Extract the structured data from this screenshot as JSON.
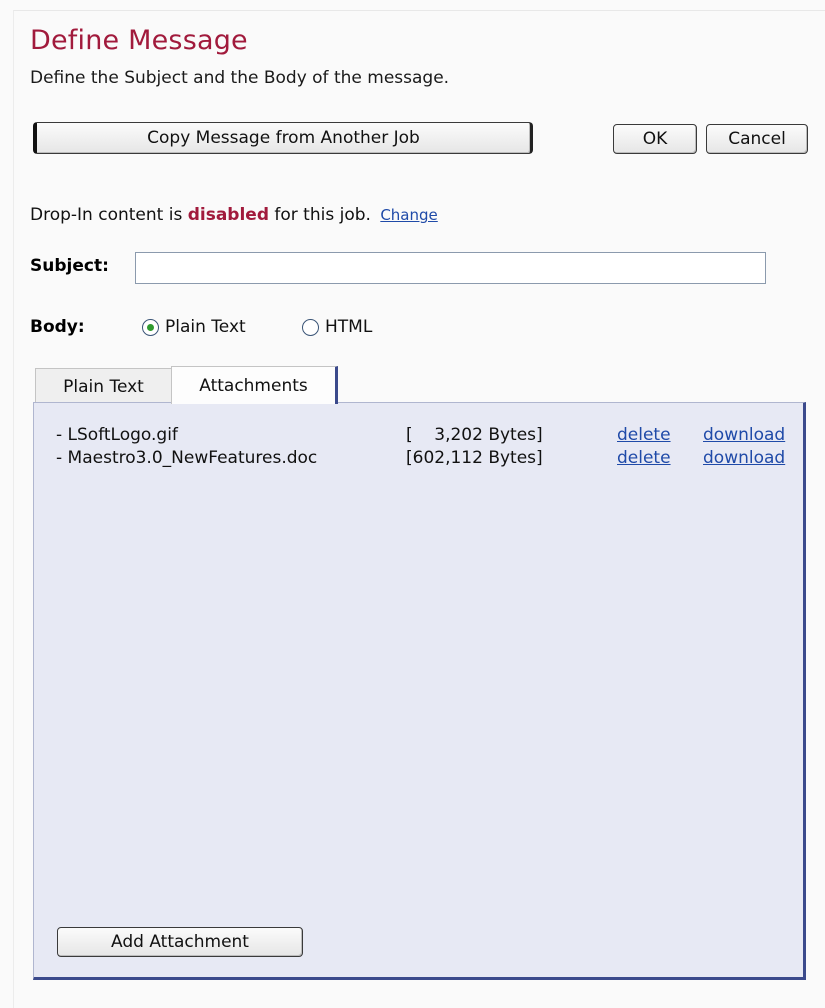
{
  "header": {
    "title": "Define Message",
    "description": "Define the Subject and the Body of the message."
  },
  "buttons": {
    "copy": "Copy Message from Another Job",
    "ok": "OK",
    "cancel": "Cancel",
    "add_attachment": "Add Attachment"
  },
  "dropin": {
    "prefix": "Drop-In content is ",
    "status": "disabled",
    "suffix": " for this job.",
    "change_link": "Change"
  },
  "subject": {
    "label": "Subject:",
    "value": ""
  },
  "body": {
    "label": "Body:",
    "options": [
      {
        "label": "Plain Text",
        "selected": true
      },
      {
        "label": "HTML",
        "selected": false
      }
    ]
  },
  "tabs": [
    {
      "label": "Plain Text",
      "active": false
    },
    {
      "label": "Attachments",
      "active": true
    }
  ],
  "attachments": [
    {
      "name": "- LSoftLogo.gif",
      "size": "[    3,202 Bytes]",
      "delete": "delete",
      "download": "download"
    },
    {
      "name": "- Maestro3.0_NewFeatures.doc",
      "size": "[602,112 Bytes]",
      "delete": "delete",
      "download": "download"
    }
  ],
  "colors": {
    "title": "#a11a3c",
    "link": "#1f4aa8",
    "panel_bg": "#e7e9f4",
    "panel_border": "#3b4a8c",
    "radio_selected": "#2f9a2f"
  }
}
